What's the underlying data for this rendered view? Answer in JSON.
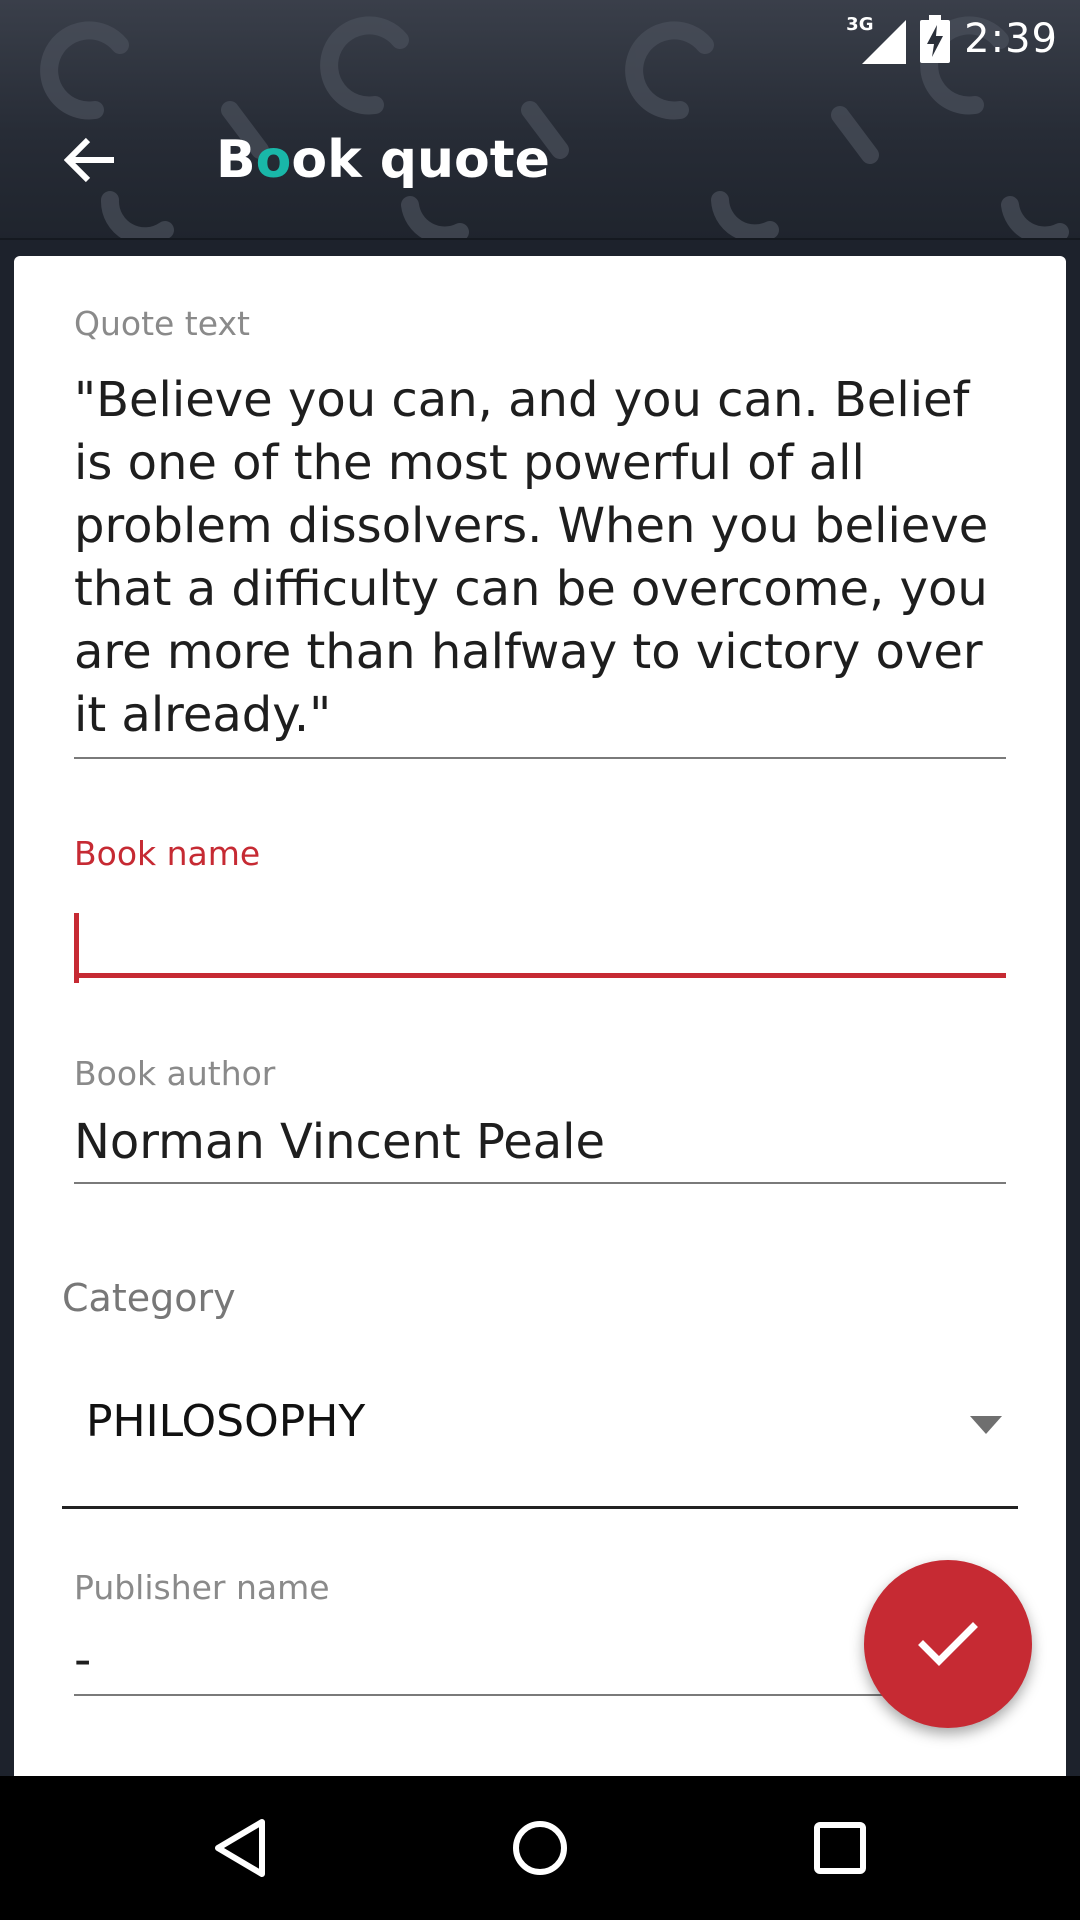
{
  "status_bar": {
    "network": "3G",
    "time": "2:39",
    "icons": [
      "signal-icon",
      "battery-charging-icon"
    ]
  },
  "toolbar": {
    "title_first": "B",
    "title_accent": "o",
    "title_rest": "ok quote",
    "back_icon": "arrow-back-icon"
  },
  "form": {
    "quote_text": {
      "label": "Quote text",
      "value": "\"Believe you can, and you can. Belief is one of the most powerful of all problem dissolvers. When you believe that a difficulty can be overcome, you are more than halfway to victory over it already.\""
    },
    "book_name": {
      "label": "Book name",
      "value": "",
      "focused": true
    },
    "book_author": {
      "label": "Book author",
      "value": "Norman Vincent Peale"
    },
    "category": {
      "label": "Category",
      "selected": "PHILOSOPHY"
    },
    "publisher_name": {
      "label": "Publisher name",
      "value": "-"
    }
  },
  "fab": {
    "icon": "check-icon"
  },
  "nav": {
    "back": "nav-back-icon",
    "home": "nav-home-icon",
    "recents": "nav-recents-icon"
  },
  "colors": {
    "accent": "#c62a33",
    "title_accent": "#19b7a8",
    "header_bg": "#2b303a"
  }
}
